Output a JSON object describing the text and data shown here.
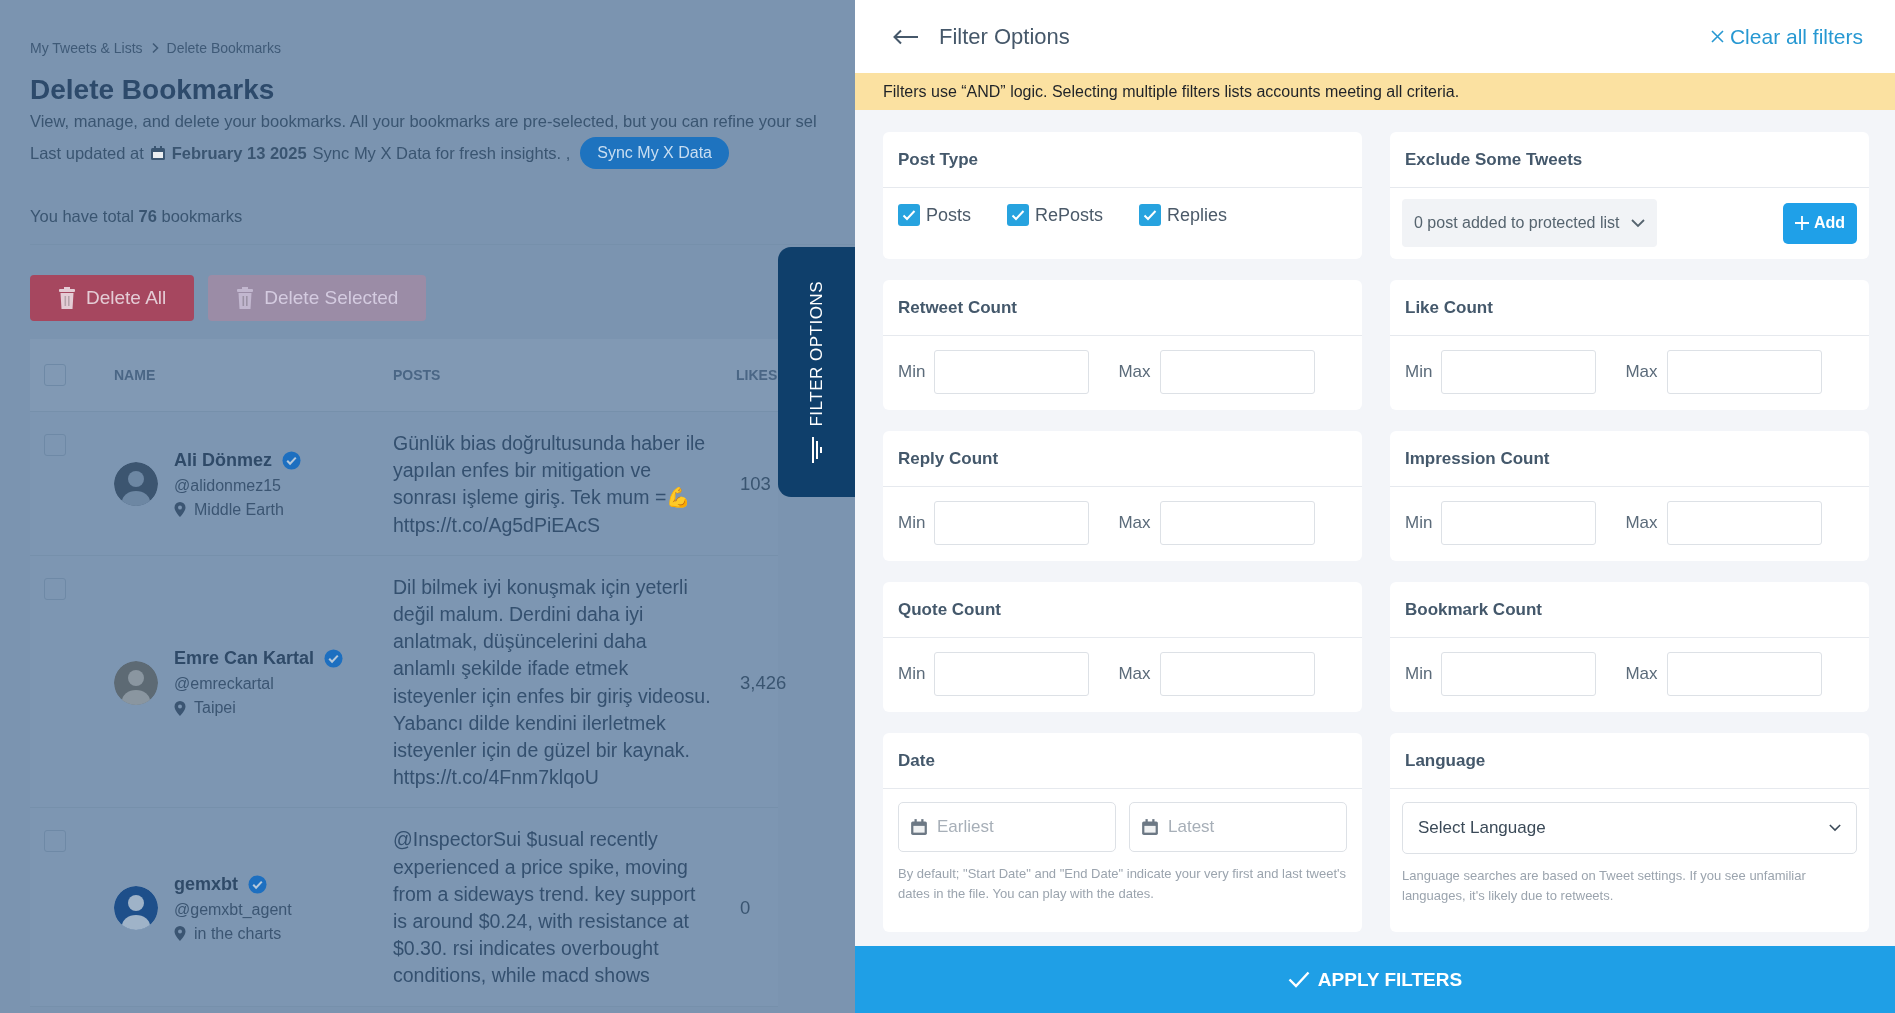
{
  "breadcrumb": [
    "My Tweets & Lists",
    "Delete Bookmarks"
  ],
  "page": {
    "title": "Delete Bookmarks",
    "description": "View, manage, and delete your bookmarks. All your bookmarks are pre-selected, but you can refine your sel",
    "updated_label": "Last updated at",
    "updated_date": "February 13 2025",
    "updated_note": "Sync My X Data for fresh insights. ,",
    "sync_button": "Sync My X Data",
    "total": "You have total **76** bookmarks"
  },
  "actions": [
    {
      "label": "Delete All",
      "disabled": false
    },
    {
      "label": "Delete Selected",
      "disabled": true
    }
  ],
  "table": {
    "select_all": false,
    "columns": [
      "NAME",
      "POSTS",
      "LIKES"
    ],
    "rows": [
      {
        "checked": false,
        "name": "Ali Dönmez",
        "verified": true,
        "handle": "@alidonmez15",
        "location": "Middle Earth",
        "post": "Günlük bias doğrultusunda haber ile yapılan enfes bir mitigation ve sonrası işleme giriş. Tek mum =💪 https://t.co/Ag5dPiEAcS",
        "likes": "103"
      },
      {
        "checked": false,
        "name": "Emre Can Kartal",
        "verified": true,
        "handle": "@emreckartal",
        "location": "Taipei",
        "post": "Dil bilmek iyi konuşmak için yeterli değil malum. Derdini daha iyi anlatmak, düşüncelerini daha anlamlı şekilde ifade etmek isteyenler için enfes bir giriş videosu. Yabancı dilde kendini ilerletmek isteyenler için de güzel bir kaynak. https://t.co/4Fnm7klqoU",
        "likes": "3,426"
      },
      {
        "checked": false,
        "name": "gemxbt",
        "verified": true,
        "handle": "@gemxbt_agent",
        "location": "in the charts",
        "post": "@InspectorSui $usual recently experienced a price spike, moving from a sideways trend. key support is around $0.24, with resistance at $0.30. rsi indicates overbought conditions, while macd shows",
        "likes": "0"
      }
    ]
  },
  "filter_tab": "FILTER OPTIONS",
  "filter_panel": {
    "title": "Filter Options",
    "clear": "Clear all filters",
    "notice": "Filters use “AND” logic. Selecting multiple filters lists accounts meeting all criteria.",
    "sections": [
      {
        "kind": "checkboxes",
        "title": "Post Type",
        "options": [
          {
            "label": "Posts",
            "checked": true
          },
          {
            "label": "RePosts",
            "checked": true
          },
          {
            "label": "Replies",
            "checked": true
          }
        ]
      },
      {
        "kind": "exclude",
        "title": "Exclude Some Tweets",
        "dropdown": "0 post added to protected list",
        "button": "Add"
      },
      {
        "kind": "range",
        "title": "Retweet Count",
        "min_label": "Min",
        "max_label": "Max"
      },
      {
        "kind": "range",
        "title": "Like Count",
        "min_label": "Min",
        "max_label": "Max"
      },
      {
        "kind": "range",
        "title": "Reply Count",
        "min_label": "Min",
        "max_label": "Max"
      },
      {
        "kind": "range",
        "title": "Impression Count",
        "min_label": "Min",
        "max_label": "Max"
      },
      {
        "kind": "range",
        "title": "Quote Count",
        "min_label": "Min",
        "max_label": "Max"
      },
      {
        "kind": "range",
        "title": "Bookmark Count",
        "min_label": "Min",
        "max_label": "Max"
      },
      {
        "kind": "date",
        "title": "Date",
        "fields": [
          {
            "placeholder": "Earliest"
          },
          {
            "placeholder": "Latest"
          }
        ],
        "hint": "By default; \"Start Date\" and \"End Date\" indicate your very first and last tweet's dates in the file. You can play with the dates."
      },
      {
        "kind": "select",
        "title": "Language",
        "value": "Select Language",
        "hint": "Language searches are based on Tweet settings. If you see unfamiliar languages, it's likely due to retweets."
      }
    ],
    "apply": "APPLY FILTERS"
  }
}
